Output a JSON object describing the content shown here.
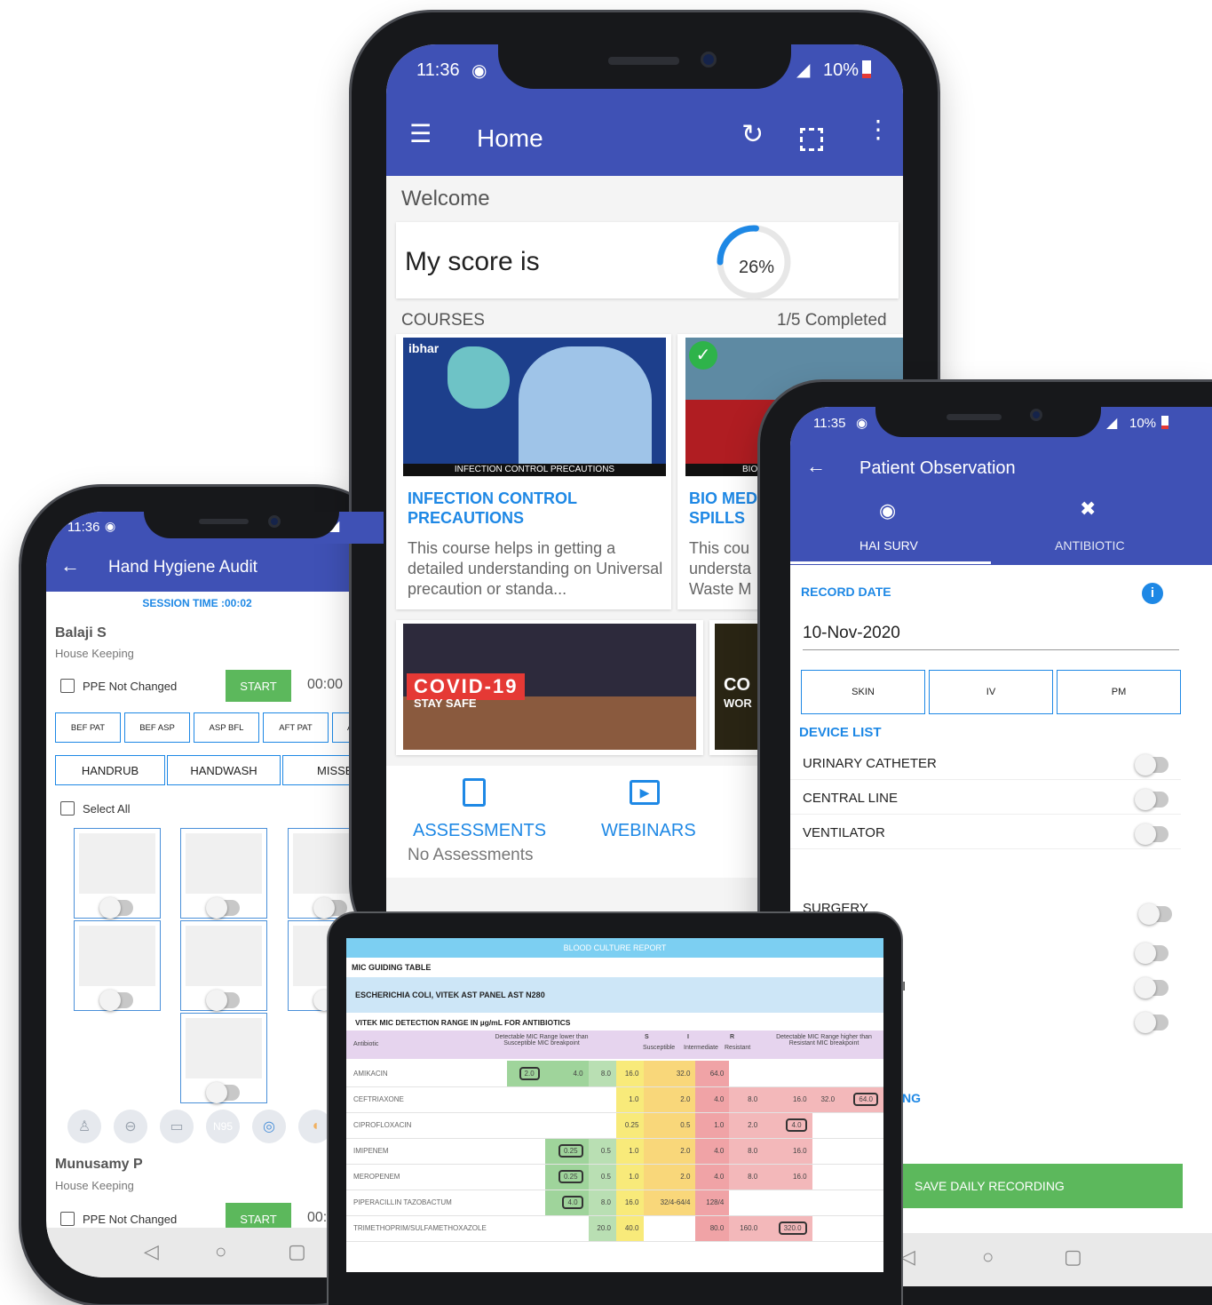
{
  "hand_hygiene": {
    "status": {
      "time": "11:36"
    },
    "appbar": {
      "title": "Hand Hygiene Audit"
    },
    "session_time": "SESSION TIME :00:02",
    "staff": [
      {
        "name": "Balaji S",
        "dept": "House Keeping",
        "ppe_label": "PPE Not Changed",
        "start_label": "START",
        "timer": "00:00"
      },
      {
        "name": "Munusamy P",
        "dept": "House Keeping",
        "ppe_label": "PPE Not Changed",
        "start_label": "START",
        "timer": "00:"
      }
    ],
    "moments": [
      "BEF PAT",
      "BEF ASP",
      "ASP BFL",
      "AFT PAT",
      "AF"
    ],
    "actions": [
      "HANDRUB",
      "HANDWASH",
      "MISSE"
    ],
    "select_all": "Select All",
    "ppe_icons": [
      "gown-icon",
      "goggles-icon",
      "mask-icon",
      "n95-icon",
      "ring-icon",
      "glove-icon"
    ],
    "ppe_n95": "N95"
  },
  "home": {
    "status": {
      "time": "11:36",
      "battery": "10%"
    },
    "appbar": {
      "title": "Home"
    },
    "welcome": "Welcome",
    "score": {
      "label": "My score is",
      "value": "26%",
      "percent": 26
    },
    "courses": {
      "label": "COURSES",
      "completed": "1/5 Completed"
    },
    "course_cards": [
      {
        "brand": "ibhar",
        "banner": "INFECTION CONTROL PRECAUTIONS",
        "title": "INFECTION CONTROL PRECAUTIONS",
        "desc": "This course helps in getting a detailed understanding on Universal precaution or standa..."
      },
      {
        "banner": "BIO",
        "title": "BIO MEDI SPILLS",
        "desc": "This cou understa Waste M"
      }
    ],
    "webinar_banner": {
      "headline": "COVID-19",
      "sub": "STAY SAFE"
    },
    "webinar_banner2": {
      "headline": "CO",
      "sub": "WOR"
    },
    "assessments": {
      "label": "ASSESSMENTS",
      "sub": "No Assessments"
    },
    "webinars": {
      "label": "WEBINARS"
    }
  },
  "patient_obs": {
    "status": {
      "time": "11:35",
      "battery": "10%"
    },
    "appbar": {
      "title": "Patient Observation"
    },
    "tabs": [
      {
        "label": "HAI SURV"
      },
      {
        "label": "ANTIBIOTIC"
      }
    ],
    "record_date_label": "RECORD DATE",
    "record_date": "10-Nov-2020",
    "sites": [
      "SKIN",
      "IV",
      "PM"
    ],
    "device_list_label": "DEVICE LIST",
    "devices": [
      "URINARY CATHETER",
      "CENTRAL LINE",
      "VENTILATOR"
    ],
    "surgery": "SURGERY",
    "partial_i": "I",
    "partial_ng": "NG",
    "save_label": "SAVE DAILY RECORDING"
  },
  "blood_culture": {
    "title": "BLOOD CULTURE REPORT",
    "table_label": "MIC GUIDING TABLE",
    "organism": "ESCHERICHIA COLI, VITEK AST PANEL AST N280",
    "range_label": "VITEK MIC DETECTION RANGE IN µg/mL FOR ANTIBIOTICS",
    "headers": {
      "antibiotic": "Antibiotic",
      "lower": "Detectable MIC Range lower than Susceptible MIC breakpoint",
      "s": "S",
      "s_sub": "Susceptible",
      "i": "I",
      "i_sub": "Intermediate",
      "r": "R",
      "r_sub": "Resistant",
      "higher": "Detectable MIC Range higher than Resistant MIC breakpoint"
    },
    "rows": [
      {
        "name": "AMIKACIN",
        "cells": [
          "",
          "",
          "2.0",
          "4.0",
          "8.0",
          "16.0",
          "32.0",
          "64.0",
          "",
          "",
          "",
          ""
        ]
      },
      {
        "name": "CEFTRIAXONE",
        "cells": [
          "",
          "",
          "",
          "",
          "",
          "1.0",
          "2.0",
          "4.0",
          "8.0",
          "16.0",
          "32.0",
          "64.0"
        ]
      },
      {
        "name": "CIPROFLOXACIN",
        "cells": [
          "",
          "",
          "",
          "",
          "",
          "0.25",
          "0.5",
          "1.0",
          "2.0",
          "4.0",
          "",
          ""
        ]
      },
      {
        "name": "IMIPENEM",
        "cells": [
          "",
          "",
          "",
          "0.25",
          "0.5",
          "1.0",
          "2.0",
          "4.0",
          "8.0",
          "16.0",
          "",
          ""
        ]
      },
      {
        "name": "MEROPENEM",
        "cells": [
          "",
          "",
          "",
          "0.25",
          "0.5",
          "1.0",
          "2.0",
          "4.0",
          "8.0",
          "16.0",
          "",
          ""
        ]
      },
      {
        "name": "PIPERACILLIN TAZOBACTUM",
        "cells": [
          "",
          "",
          "",
          "4.0",
          "8.0",
          "16.0",
          "32/4-64/4",
          "128/4",
          "",
          "",
          "",
          ""
        ]
      },
      {
        "name": "TRIMETHOPRIM/SULFAMETHOXAZOLE",
        "cells": [
          "",
          "",
          "",
          "",
          "20.0",
          "40.0",
          "",
          "80.0",
          "160.0",
          "320.0",
          "",
          ""
        ]
      }
    ]
  }
}
